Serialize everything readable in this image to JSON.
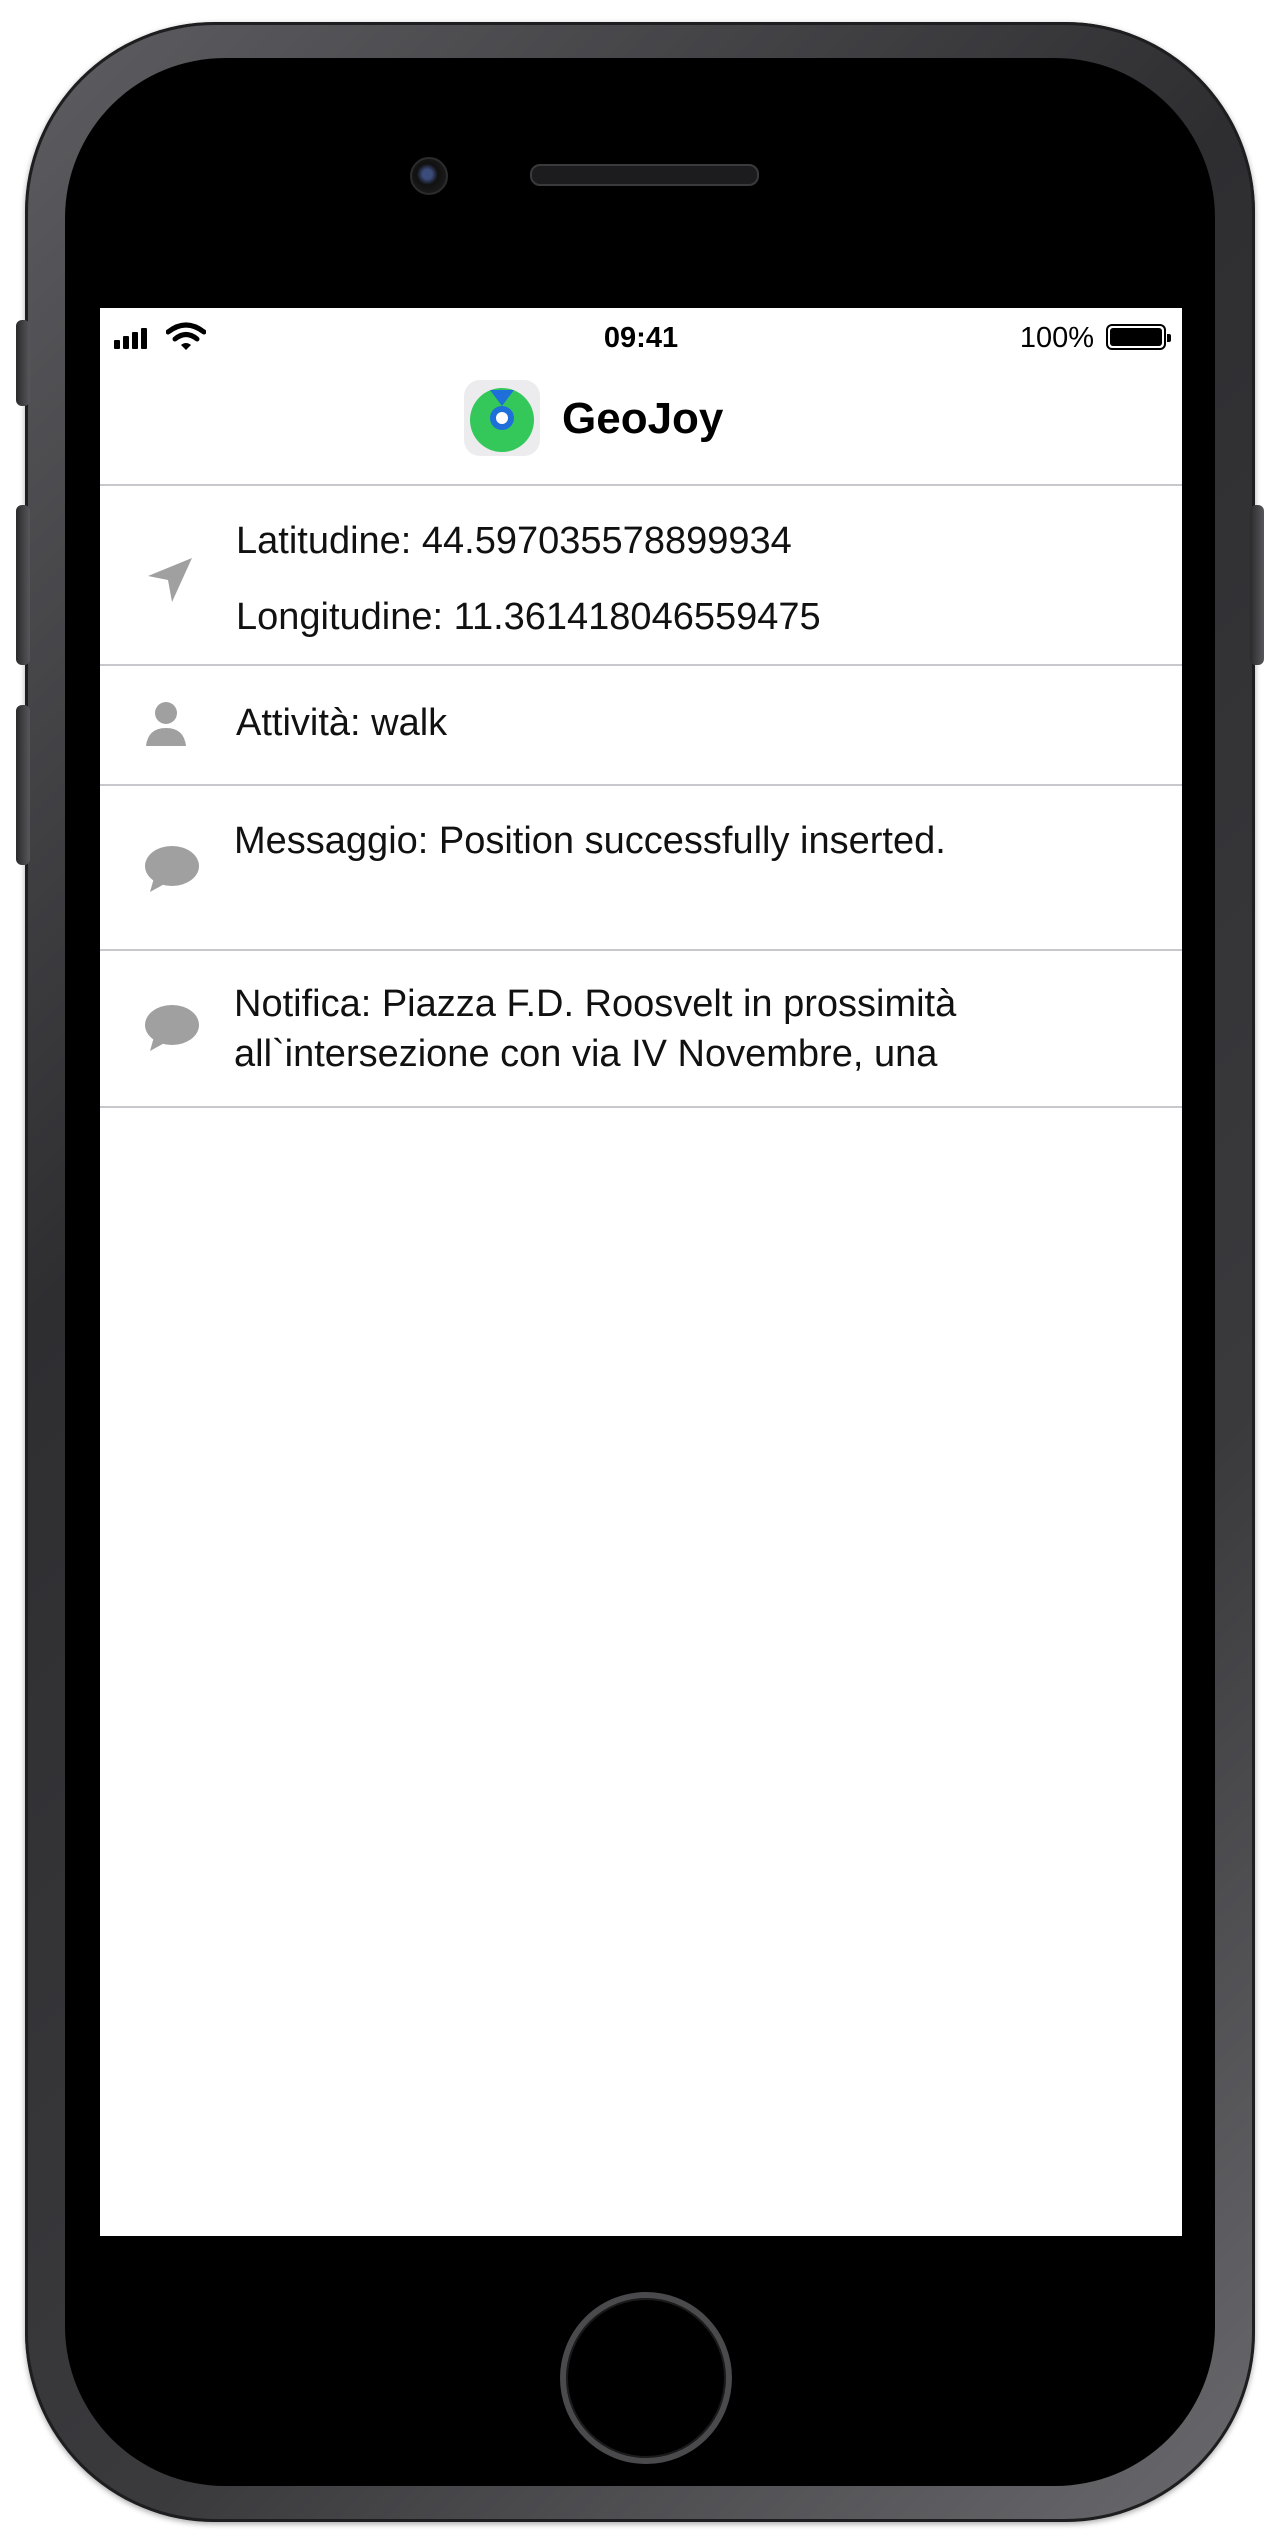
{
  "status_bar": {
    "time": "09:41",
    "battery_percent": "100%",
    "signal_bars": 4,
    "battery_level": 1.0
  },
  "nav": {
    "app_title": "GeoJoy",
    "app_icon": "geojoy-app-icon"
  },
  "rows": {
    "location": {
      "icon": "location-arrow-icon",
      "latitude": "Latitudine: 44.597035578899934",
      "longitude": "Longitudine: 11.361418046559475"
    },
    "activity": {
      "icon": "person-icon",
      "text": "Attività: walk"
    },
    "message": {
      "icon": "speech-bubble-icon",
      "text": "Messaggio: Position successfully inserted."
    },
    "notification": {
      "icon": "speech-bubble-icon",
      "text": "Notifica: Piazza F.D. Roosvelt in prossimità all`intersezione con via IV Novembre, una"
    }
  },
  "colors": {
    "separator": "#c8c8cc",
    "icon_gray": "#a0a0a0",
    "app_icon_green": "#34c759",
    "app_icon_blue": "#1e6fd9"
  }
}
